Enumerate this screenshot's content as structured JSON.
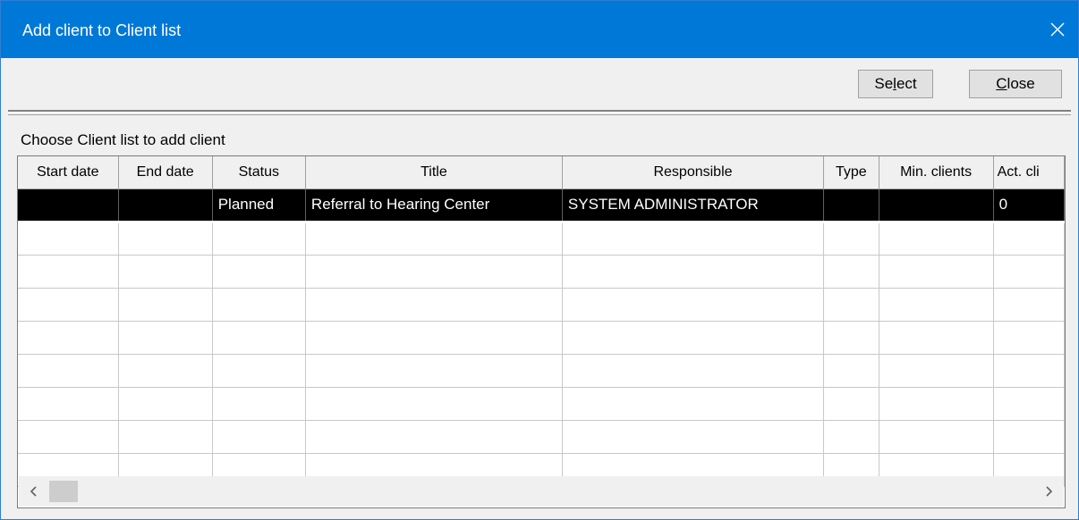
{
  "window": {
    "title": "Add client to Client list",
    "close_glyph": "✕",
    "title_bar_color": "#0078d7"
  },
  "toolbar": {
    "select_label_pre": "Se",
    "select_label_mnemonic": "l",
    "select_label_post": "ect",
    "close_label_mnemonic": "C",
    "close_label_post": "lose"
  },
  "group": {
    "label": "Choose Client list to add client"
  },
  "grid": {
    "columns": [
      "Start date",
      "End date",
      "Status",
      "Title",
      "Responsible",
      "Type",
      "Min. clients",
      "Act. cli"
    ],
    "rows": [
      [
        "",
        "",
        "Planned",
        "Referral to Hearing Center",
        "SYSTEM ADMINISTRATOR",
        "",
        "",
        "0"
      ]
    ],
    "selected_row": 0
  },
  "scrollbar": {
    "left_icon": "chevron-left-icon",
    "right_icon": "chevron-right-icon"
  }
}
